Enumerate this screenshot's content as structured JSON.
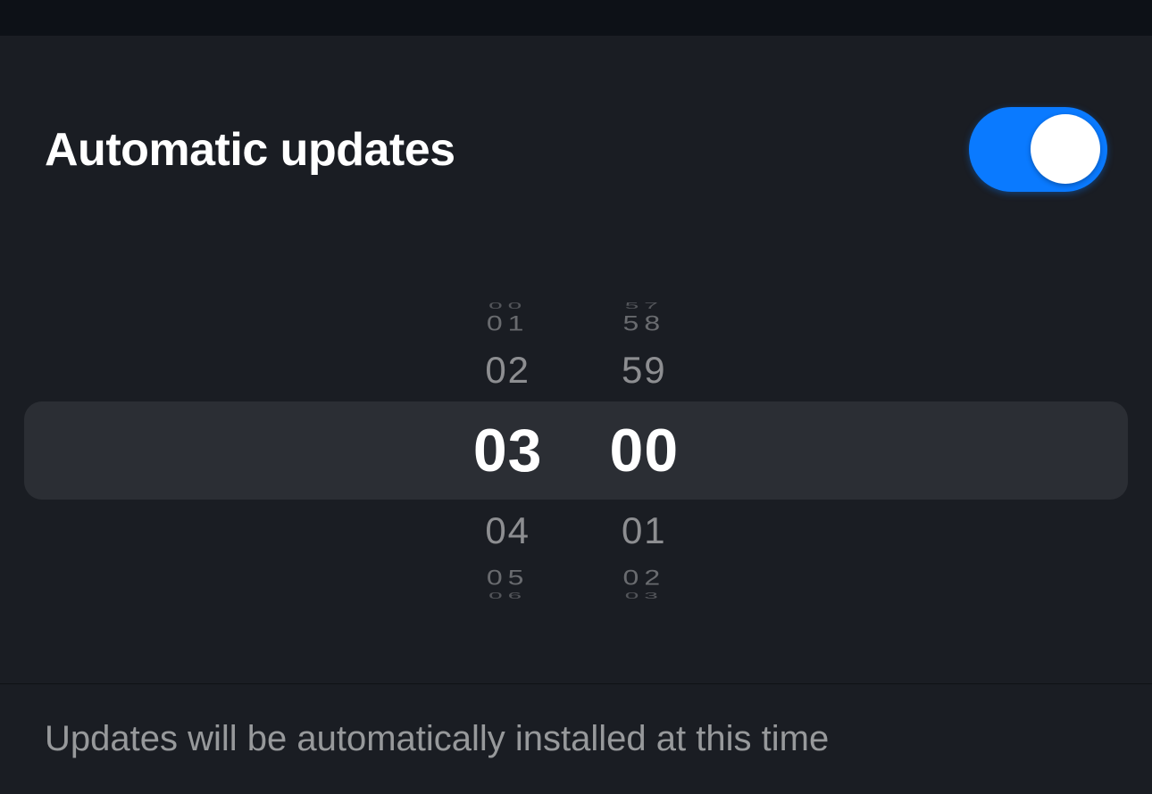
{
  "header": {
    "title": "Automatic updates",
    "toggle_on": true
  },
  "time_picker": {
    "hours": {
      "edge_top": "00",
      "far_top": "01",
      "near_top": "02",
      "selected": "03",
      "near_bottom": "04",
      "far_bottom": "05",
      "edge_bottom": "06"
    },
    "minutes": {
      "edge_top": "57",
      "far_top": "58",
      "near_top": "59",
      "selected": "00",
      "near_bottom": "01",
      "far_bottom": "02",
      "edge_bottom": "03"
    }
  },
  "footer": {
    "description": "Updates will be automatically installed at this time"
  },
  "colors": {
    "accent": "#0a7aff",
    "background": "#0d1117",
    "panel": "#1a1d23"
  }
}
